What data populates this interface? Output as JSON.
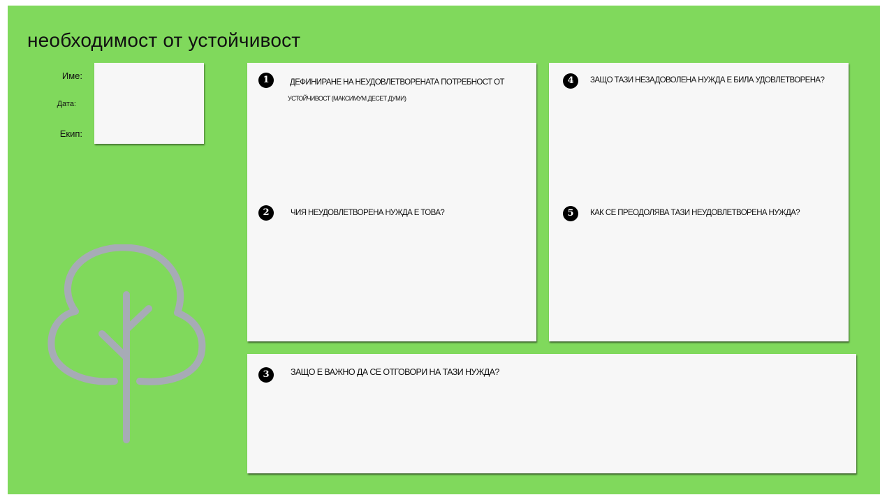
{
  "title": "необходимост от устойчивост",
  "fields": {
    "name_label": "Име:",
    "date_label": "Дата:",
    "team_label": "Екип:"
  },
  "questions": [
    {
      "number": "1",
      "text": "ДЕФИНИРАНЕ НА НЕУДОВЛЕТВОРЕНАТА ПОТРЕБНОСТ ОТ",
      "subtext": "УСТОЙЧИВОСТ (МАКСИМУМ ДЕСЕТ ДУМИ)"
    },
    {
      "number": "2",
      "text": "ЧИЯ НЕУДОВЛЕТВОРЕНА НУЖДА Е ТОВА?"
    },
    {
      "number": "3",
      "text": "ЗАЩО Е ВАЖНО ДА СЕ ОТГОВОРИ НА ТАЗИ НУЖДА?"
    },
    {
      "number": "4",
      "text": "ЗАЩО ТАЗИ НЕЗАДОВОЛЕНА НУЖДА Е БИЛА УДОВЛЕТВОРЕНА?"
    },
    {
      "number": "5",
      "text": "КАК СЕ ПРЕОДОЛЯВА ТАЗИ НЕУДОВЛЕТВОРЕНА НУЖДА?"
    }
  ],
  "colors": {
    "background": "#80d95c",
    "card": "#f7f7f7",
    "tree": "#a7abb6",
    "badge": "#000000"
  },
  "icons": [
    "tree-icon"
  ]
}
